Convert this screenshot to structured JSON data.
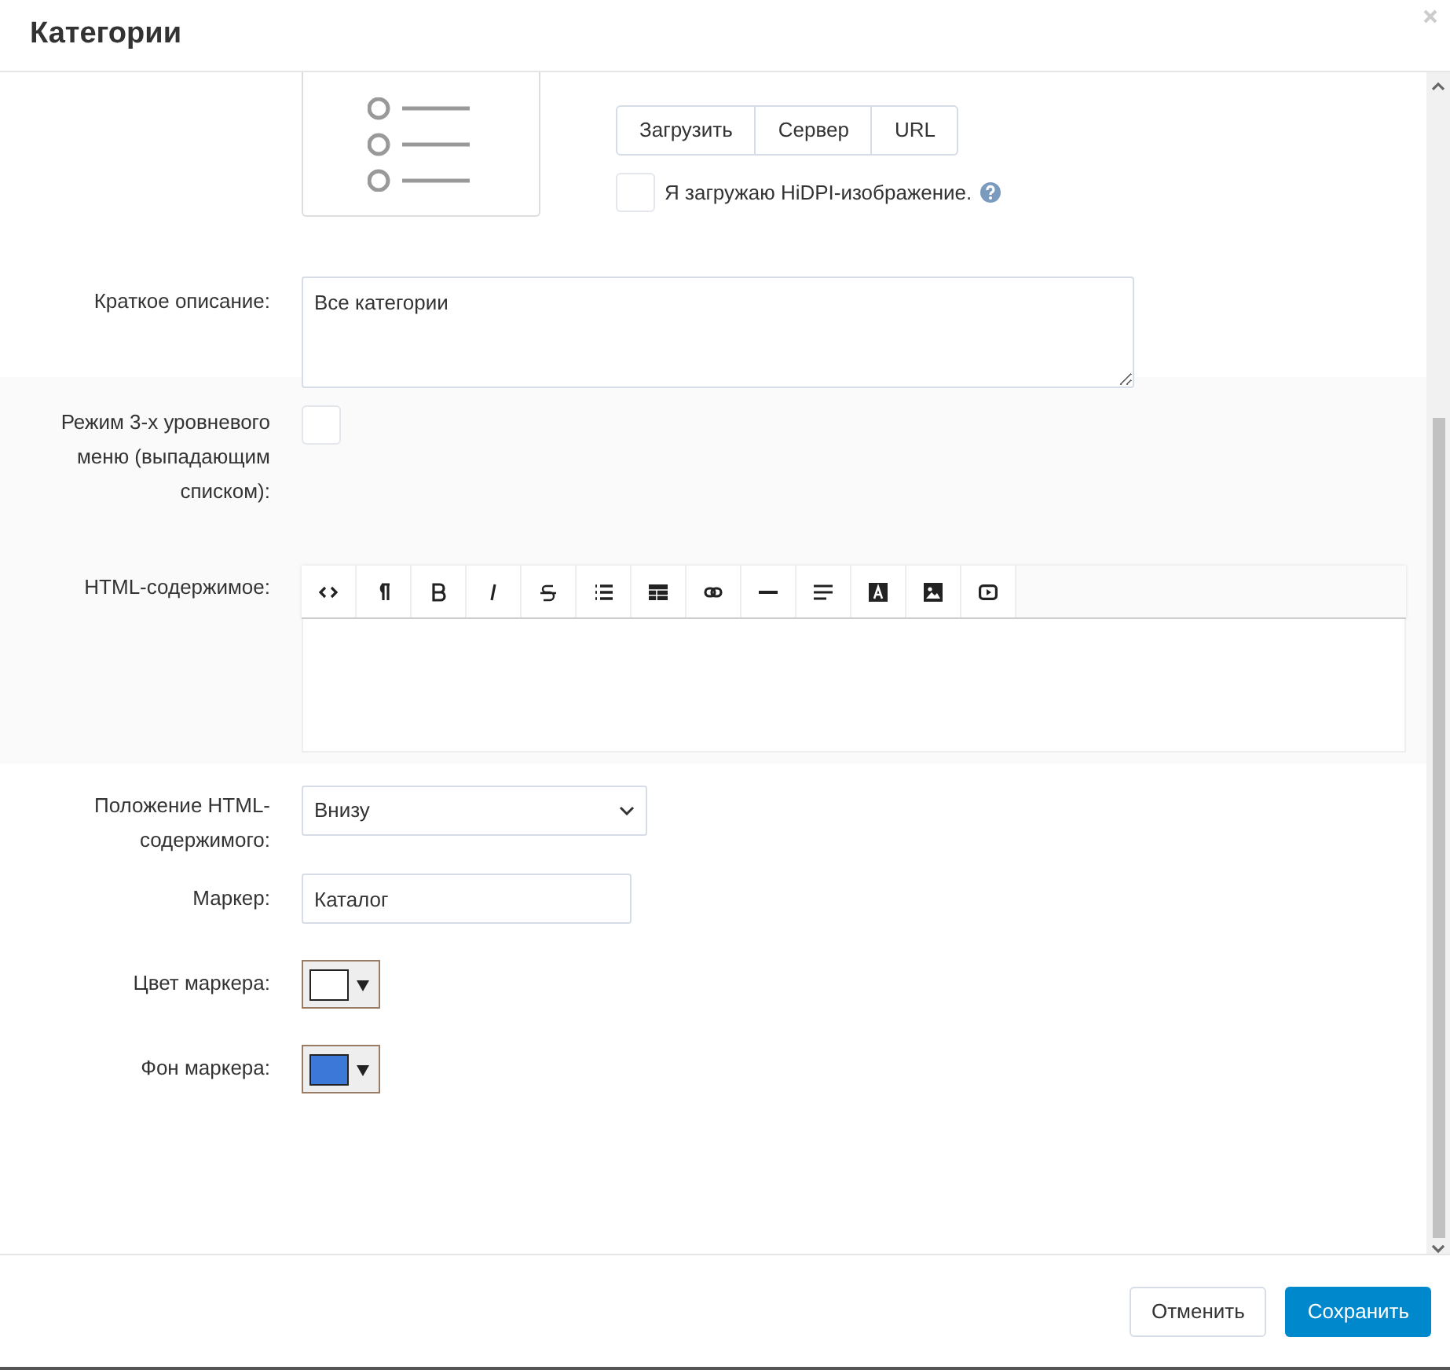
{
  "window": {
    "title": "Категории"
  },
  "icon_section": {
    "source_buttons": [
      "Загрузить",
      "Сервер",
      "URL"
    ],
    "hidpi": {
      "label": "Я загружаю HiDPI-изображение.",
      "checked": false
    }
  },
  "fields": [
    {
      "kind": "textarea",
      "label": "Краткое описание:",
      "value": "Все категории"
    },
    {
      "kind": "checkbox",
      "label": "Режим 3-х уровневого меню (выпадающим списком):",
      "checked": false
    },
    {
      "kind": "editor",
      "label": "HTML-содержимое:"
    },
    {
      "kind": "select",
      "label": "Положение HTML-содержимого:",
      "value": "Внизу"
    },
    {
      "kind": "input",
      "label": "Маркер:",
      "value": "Каталог"
    },
    {
      "kind": "color",
      "label": "Цвет маркера:",
      "color": "#ffffff"
    },
    {
      "kind": "color",
      "label": "Фон маркера:",
      "color": "#3c78d8"
    }
  ],
  "footer": {
    "buttons": [
      {
        "label": "Отменить",
        "kind": "secondary"
      },
      {
        "label": "Сохранить",
        "kind": "primary"
      }
    ]
  }
}
